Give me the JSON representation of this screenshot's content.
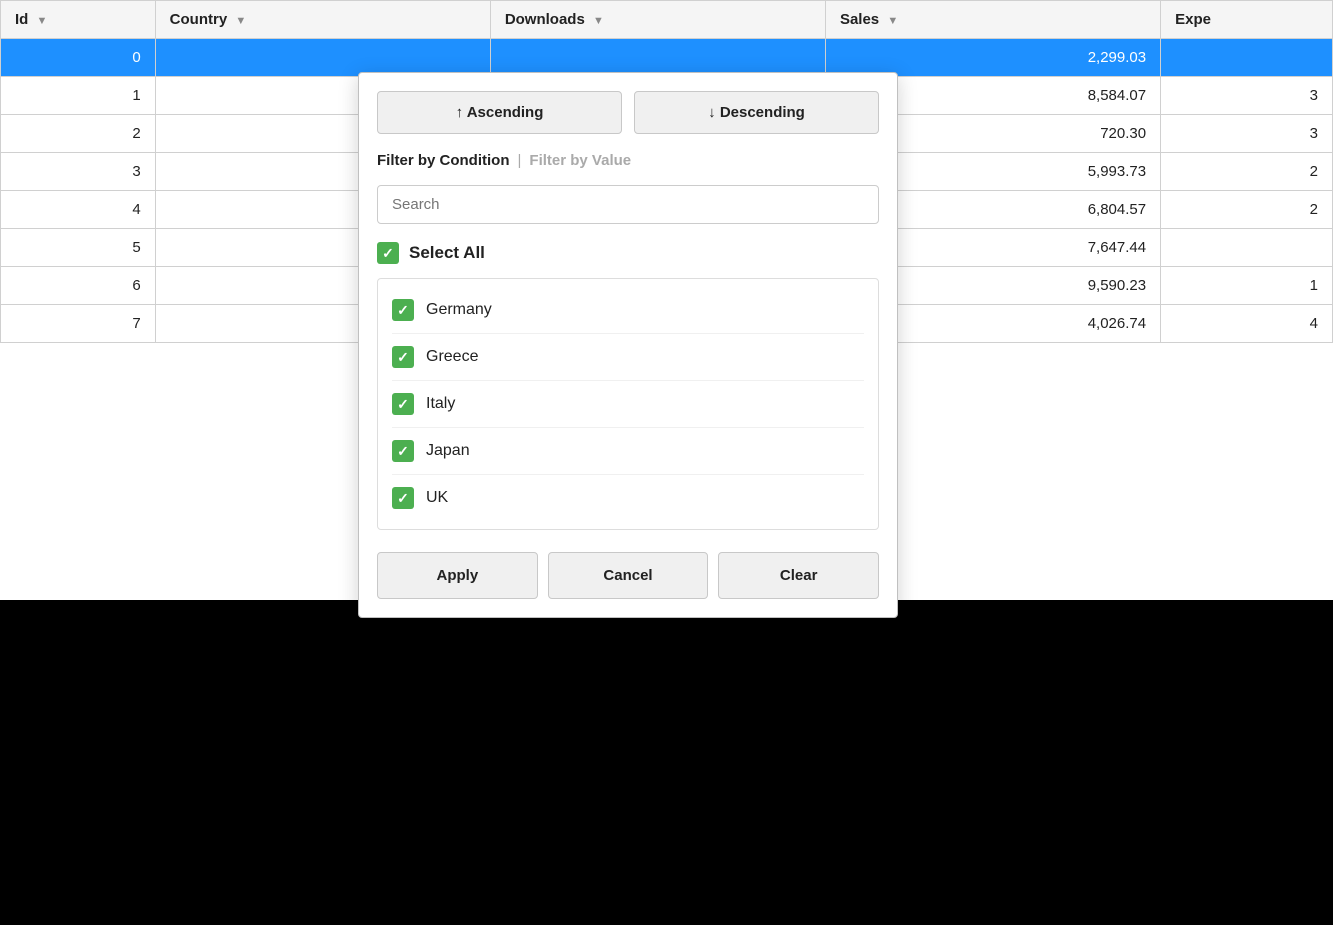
{
  "table": {
    "columns": [
      {
        "key": "id",
        "label": "Id",
        "hasFilter": true
      },
      {
        "key": "country",
        "label": "Country",
        "hasFilter": true
      },
      {
        "key": "downloads",
        "label": "Downloads",
        "hasFilter": true
      },
      {
        "key": "sales",
        "label": "Sales",
        "hasFilter": true
      },
      {
        "key": "expe",
        "label": "Expe",
        "hasFilter": false
      }
    ],
    "rows": [
      {
        "id": "0",
        "sales": "2,299.03",
        "expe": "",
        "selected": true
      },
      {
        "id": "1",
        "sales": "8,584.07",
        "expe": "3"
      },
      {
        "id": "2",
        "sales": "720.30",
        "expe": "3"
      },
      {
        "id": "3",
        "sales": "5,993.73",
        "expe": "2"
      },
      {
        "id": "4",
        "sales": "6,804.57",
        "expe": "2"
      },
      {
        "id": "5",
        "sales": "7,647.44",
        "expe": ""
      },
      {
        "id": "6",
        "sales": "9,590.23",
        "expe": "1"
      },
      {
        "id": "7",
        "sales": "4,026.74",
        "expe": "4"
      }
    ]
  },
  "filterPopup": {
    "sortAscLabel": "↑ Ascending",
    "sortDescLabel": "↓ Descending",
    "filterByConditionLabel": "Filter by Condition",
    "filterSeparator": "|",
    "filterByValueLabel": "Filter by Value",
    "searchPlaceholder": "Search",
    "selectAllLabel": "Select All",
    "countries": [
      "Germany",
      "Greece",
      "Italy",
      "Japan",
      "UK"
    ],
    "applyLabel": "Apply",
    "cancelLabel": "Cancel",
    "clearLabel": "Clear"
  }
}
